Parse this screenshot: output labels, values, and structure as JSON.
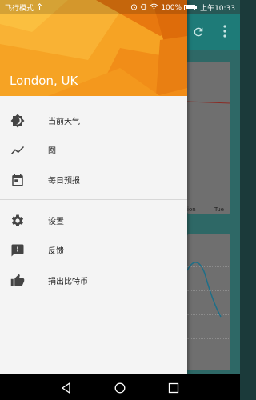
{
  "status": {
    "left_text": "飞行模式",
    "battery": "100%",
    "time": "上午10:33"
  },
  "drawer": {
    "location": "London, UK",
    "header_color": "#f08c14",
    "items": [
      {
        "label": "当前天气",
        "icon": "brightness-icon"
      },
      {
        "label": "图",
        "icon": "trending-chart-icon"
      },
      {
        "label": "每日预报",
        "icon": "calendar-icon"
      },
      {
        "label": "设置",
        "icon": "gear-icon"
      },
      {
        "label": "反馈",
        "icon": "feedback-icon"
      },
      {
        "label": "捐出比特币",
        "icon": "thumb-up-icon"
      }
    ]
  },
  "background": {
    "day_labels": [
      "ion",
      "Tue"
    ],
    "accent_color": "#1e7b78"
  },
  "nav": {
    "buttons": [
      "back",
      "home",
      "recents"
    ]
  }
}
